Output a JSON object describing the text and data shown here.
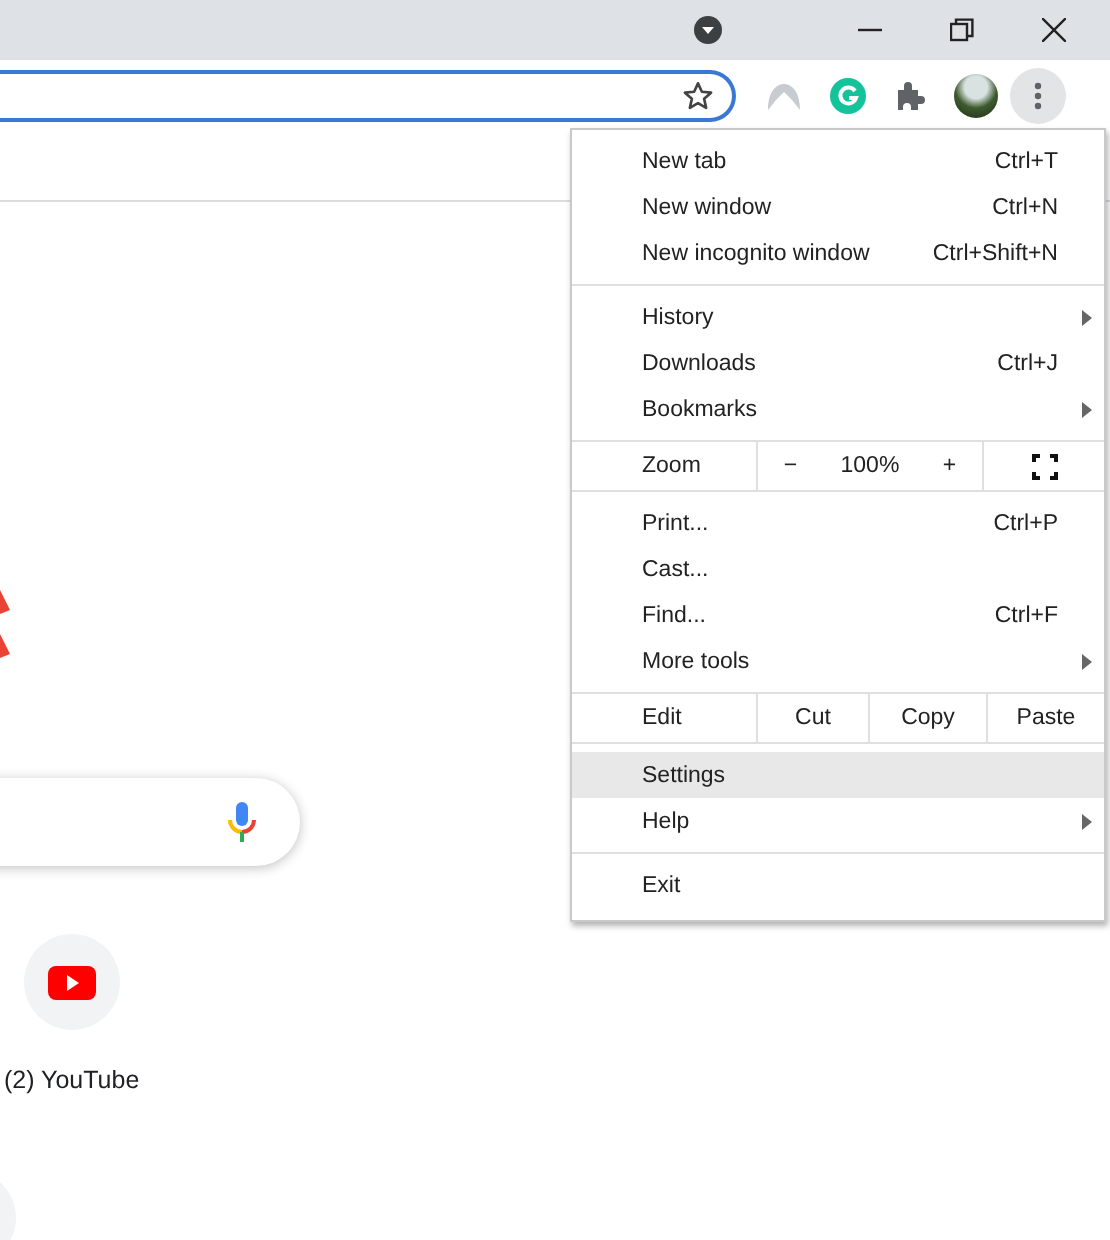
{
  "menu": {
    "sections": [
      {
        "items": [
          {
            "kind": "item",
            "label": "New tab",
            "shortcut": "Ctrl+T",
            "submenu": false,
            "selected": false
          },
          {
            "kind": "item",
            "label": "New window",
            "shortcut": "Ctrl+N",
            "submenu": false,
            "selected": false
          },
          {
            "kind": "item",
            "label": "New incognito window",
            "shortcut": "Ctrl+Shift+N",
            "submenu": false,
            "selected": false
          }
        ]
      },
      {
        "items": [
          {
            "kind": "item",
            "label": "History",
            "submenu": true,
            "selected": false
          },
          {
            "kind": "item",
            "label": "Downloads",
            "shortcut": "Ctrl+J",
            "submenu": false,
            "selected": false
          },
          {
            "kind": "item",
            "label": "Bookmarks",
            "submenu": true,
            "selected": false
          }
        ]
      },
      {
        "items": [
          {
            "kind": "zoom",
            "label": "Zoom",
            "minus": "−",
            "value": "100%",
            "plus": "+"
          }
        ]
      },
      {
        "items": [
          {
            "kind": "item",
            "label": "Print...",
            "shortcut": "Ctrl+P",
            "submenu": false,
            "selected": false
          },
          {
            "kind": "item",
            "label": "Cast...",
            "submenu": false,
            "selected": false
          },
          {
            "kind": "item",
            "label": "Find...",
            "shortcut": "Ctrl+F",
            "submenu": false,
            "selected": false
          },
          {
            "kind": "item",
            "label": "More tools",
            "submenu": true,
            "selected": false
          }
        ]
      },
      {
        "items": [
          {
            "kind": "edit",
            "label": "Edit",
            "buttons": [
              "Cut",
              "Copy",
              "Paste"
            ]
          }
        ]
      },
      {
        "items": [
          {
            "kind": "item",
            "label": "Settings",
            "submenu": false,
            "selected": true
          },
          {
            "kind": "item",
            "label": "Help",
            "submenu": true,
            "selected": false
          }
        ]
      },
      {
        "items": [
          {
            "kind": "item",
            "label": "Exit",
            "submenu": false,
            "selected": false
          }
        ]
      }
    ]
  },
  "shortcuts": [
    {
      "label": "(2) YouTube"
    }
  ]
}
